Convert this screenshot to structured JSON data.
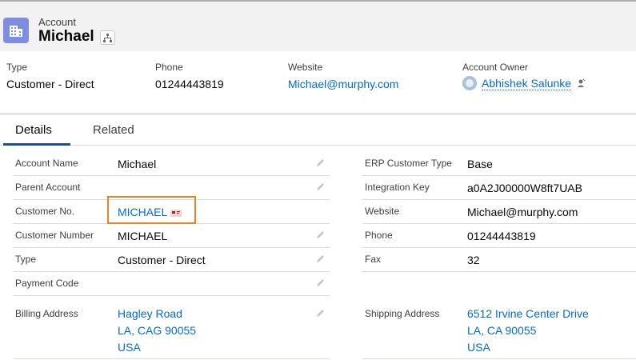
{
  "header": {
    "object_label": "Account",
    "record_name": "Michael",
    "icons": {
      "account": "building-icon",
      "hierarchy": "hierarchy-icon"
    },
    "accent_color": "#7f8de1"
  },
  "highlights": [
    {
      "label": "Type",
      "value": "Customer - Direct"
    },
    {
      "label": "Phone",
      "value": "01244443819"
    },
    {
      "label": "Website",
      "value": "Michael@murphy.com"
    },
    {
      "label": "Account Owner",
      "value": "Abhishek Salunke"
    }
  ],
  "tabs": [
    {
      "label": "Details",
      "active": true
    },
    {
      "label": "Related",
      "active": false
    }
  ],
  "left_fields": [
    {
      "label": "Account Name",
      "value": "Michael"
    },
    {
      "label": "Parent Account",
      "value": ""
    },
    {
      "label": "Customer No.",
      "value": "MICHAEL"
    },
    {
      "label": "Customer Number",
      "value": "MICHAEL"
    },
    {
      "label": "Type",
      "value": "Customer - Direct"
    },
    {
      "label": "Payment Code",
      "value": ""
    },
    {
      "label": "Billing Address",
      "lines": [
        "Hagley Road",
        "LA, CAG 90055",
        "USA"
      ]
    }
  ],
  "right_fields": [
    {
      "label": "ERP Customer Type",
      "value": "Base"
    },
    {
      "label": "Integration Key",
      "value": "a0A2J00000W8ft7UAB"
    },
    {
      "label": "Website",
      "value": "Michael@murphy.com"
    },
    {
      "label": "Phone",
      "value": "01244443819"
    },
    {
      "label": "Fax",
      "value": "32"
    },
    {
      "label": "Shipping Address",
      "lines": [
        "6512 Irvine Center Drive",
        "LA, CA 90055",
        "USA"
      ]
    }
  ],
  "colors": {
    "link": "#006dcc",
    "highlight_box": "#e8832a",
    "tab_underline": "#1b5297"
  }
}
